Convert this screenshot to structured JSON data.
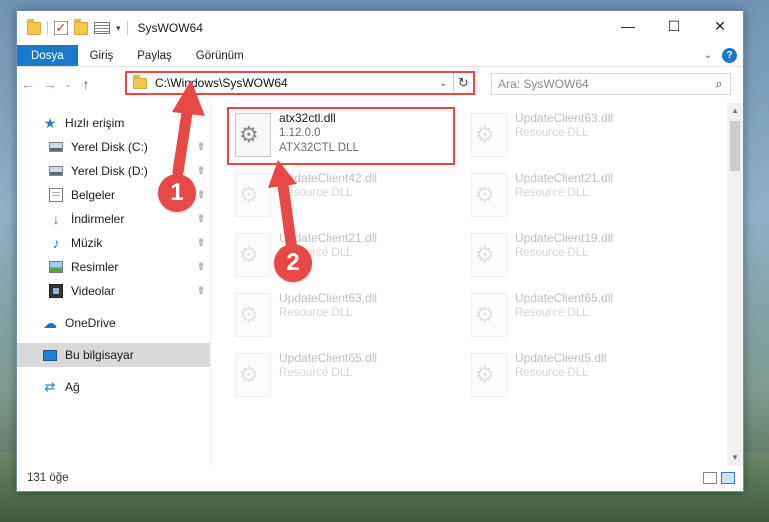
{
  "window": {
    "title": "SysWOW64",
    "controls": {
      "minimize": "—",
      "maximize": "☐",
      "close": "✕"
    }
  },
  "ribbon": {
    "tabs": [
      "Dosya",
      "Giriş",
      "Paylaş",
      "Görünüm"
    ],
    "help": "?",
    "collapse": "⌄"
  },
  "address": {
    "path": "C:\\Windows\\SysWOW64",
    "dropdown": "⌄",
    "refresh": "↻"
  },
  "nav_buttons": {
    "back": "←",
    "forward": "→",
    "recent": "⌄",
    "up": "↑"
  },
  "search": {
    "placeholder": "Ara: SysWOW64",
    "icon": "⌕"
  },
  "sidebar": {
    "items": [
      {
        "label": "Hızlı erişim",
        "icon": "star-icon",
        "glyph": "★",
        "pinned": false
      },
      {
        "label": "Yerel Disk (C:)",
        "icon": "drive-icon",
        "glyph": "",
        "pinned": true
      },
      {
        "label": "Yerel Disk (D:)",
        "icon": "drive-icon",
        "glyph": "",
        "pinned": true
      },
      {
        "label": "Belgeler",
        "icon": "documents-icon",
        "glyph": "",
        "pinned": true
      },
      {
        "label": "İndirmeler",
        "icon": "download-icon",
        "glyph": "↓",
        "pinned": true
      },
      {
        "label": "Müzik",
        "icon": "music-icon",
        "glyph": "♪",
        "pinned": true
      },
      {
        "label": "Resimler",
        "icon": "pictures-icon",
        "glyph": "",
        "pinned": true
      },
      {
        "label": "Videolar",
        "icon": "video-icon",
        "glyph": "",
        "pinned": true
      },
      {
        "label": "OneDrive",
        "icon": "cloud-icon",
        "glyph": "☁",
        "pinned": false
      },
      {
        "label": "Bu bilgisayar",
        "icon": "computer-icon",
        "glyph": "",
        "pinned": false,
        "selected": true
      },
      {
        "label": "Ağ",
        "icon": "network-icon",
        "glyph": "⇄",
        "pinned": false
      }
    ],
    "pin_glyph": "📌"
  },
  "files": [
    {
      "name": "atx32ctl.dll",
      "version": "1.12.0.0",
      "description": "ATX32CTL DLL",
      "highlighted": true
    },
    {
      "name": "UpdateClient63.dll",
      "description": "Resource DLL"
    },
    {
      "name": "UpdateClient42.dll",
      "description": "Resource DLL"
    },
    {
      "name": "UpdateClient21.dll",
      "description": "Resource DLL"
    },
    {
      "name": "UpdateClient21.dll",
      "description": "Resource DLL"
    },
    {
      "name": "UpdateClient19.dll",
      "description": "Resource DLL"
    },
    {
      "name": "UpdateClient63.dll",
      "description": "Resource DLL"
    },
    {
      "name": "UpdateClient65.dll",
      "description": "Resource DLL"
    },
    {
      "name": "UpdateClient65.dll",
      "description": "Resource DLL"
    },
    {
      "name": "UpdateClient5.dll",
      "description": "Resource DLL"
    }
  ],
  "status": {
    "count": "131 öğe"
  },
  "annotations": {
    "marker1": "1",
    "marker2": "2",
    "color": "#e84848"
  }
}
